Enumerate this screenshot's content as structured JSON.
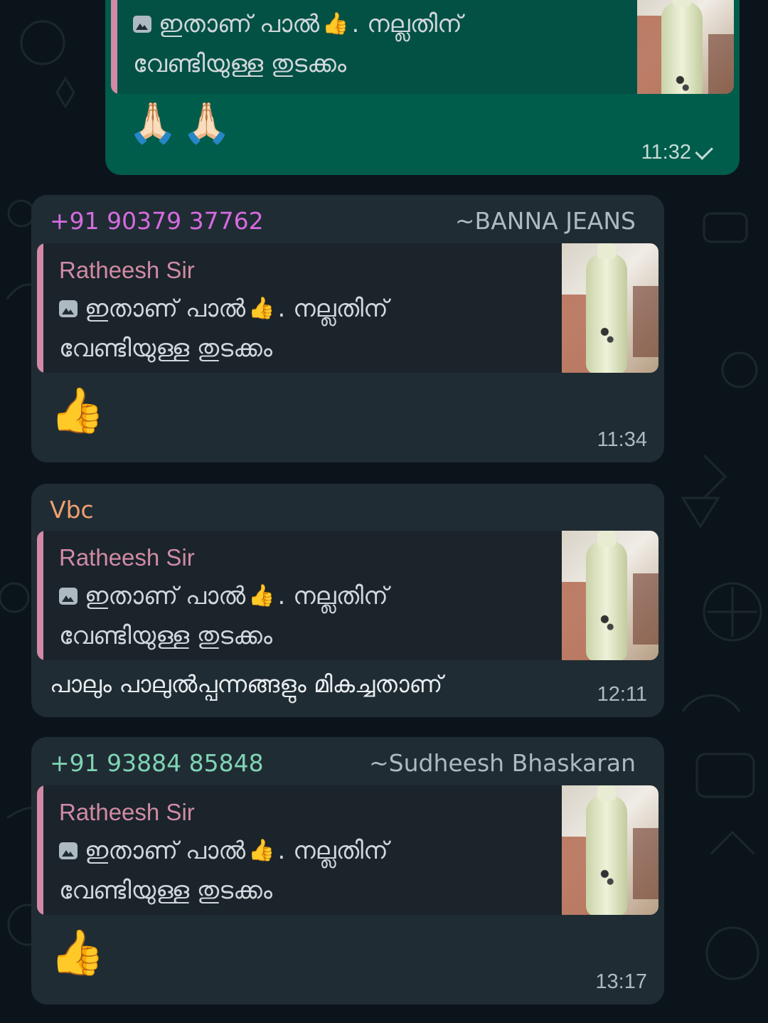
{
  "quoted_message": {
    "author": "Ratheesh Sir",
    "line1_a": "ഇതാണ് പാൽ",
    "line1_emoji": "👍",
    "line1_b": ". നല്ലതിന്",
    "line2": "വേണ്ടിയുള്ള തുടക്കം",
    "attachment_icon": "photo-icon"
  },
  "messages": [
    {
      "id": "m1",
      "direction": "outgoing",
      "body_emoji": "🙏🏻🙏🏻",
      "time": "11:32",
      "status_icon": "single-check-icon"
    },
    {
      "id": "m2",
      "direction": "incoming",
      "sender_phone": "+91 90379 37762",
      "sender_push_name": "~BANNA JEANS",
      "sender_color": "#d66be0",
      "body_emoji": "👍",
      "time": "11:34"
    },
    {
      "id": "m3",
      "direction": "incoming",
      "sender_name": "Vbc",
      "sender_color": "#f0a071",
      "body_text": "പാലും പാലുൽപ്പന്നങ്ങളും മികച്ചതാണ്",
      "time": "12:11"
    },
    {
      "id": "m4",
      "direction": "incoming",
      "sender_phone": "+91 93884 85848",
      "sender_push_name": "~Sudheesh Bhaskaran",
      "sender_color": "#7fd4b4",
      "body_emoji": "👍",
      "time": "13:17"
    }
  ],
  "colors": {
    "background": "#0b141a",
    "incoming_bubble": "#202c33",
    "outgoing_bubble": "#005c4b",
    "quote_accent": "#d28aa6"
  }
}
